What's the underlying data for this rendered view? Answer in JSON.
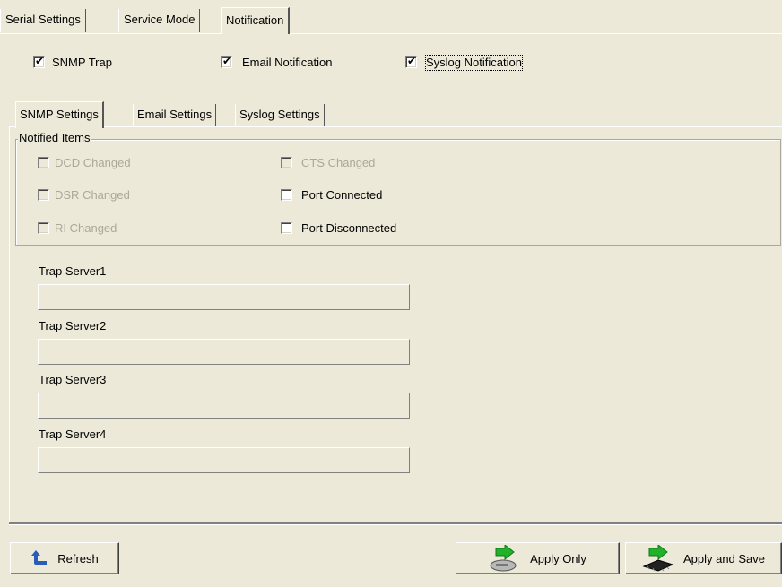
{
  "top_tabs": [
    {
      "label": "Serial Settings"
    },
    {
      "label": "Service Mode"
    },
    {
      "label": "Notification",
      "active": true
    }
  ],
  "notify_options": [
    {
      "label": "SNMP Trap",
      "checked": true
    },
    {
      "label": "Email Notification",
      "checked": true
    },
    {
      "label": "Syslog Notification",
      "checked": true,
      "focused": true
    }
  ],
  "inner_tabs": [
    {
      "label": "SNMP Settings",
      "active": true
    },
    {
      "label": "Email Settings"
    },
    {
      "label": "Syslog Settings"
    }
  ],
  "notified_items": {
    "title": "Notified Items",
    "items": [
      {
        "label": "DCD Changed",
        "checked": false,
        "enabled": false
      },
      {
        "label": "CTS Changed",
        "checked": false,
        "enabled": false
      },
      {
        "label": "DSR Changed",
        "checked": false,
        "enabled": false
      },
      {
        "label": "Port Connected",
        "checked": false,
        "enabled": true
      },
      {
        "label": "RI Changed",
        "checked": false,
        "enabled": false
      },
      {
        "label": "Port Disconnected",
        "checked": false,
        "enabled": true
      }
    ]
  },
  "trap_servers": [
    {
      "label": "Trap Server1",
      "value": ""
    },
    {
      "label": "Trap Server2",
      "value": ""
    },
    {
      "label": "Trap Server3",
      "value": ""
    },
    {
      "label": "Trap Server4",
      "value": ""
    }
  ],
  "buttons": {
    "refresh": "Refresh",
    "apply_only": "Apply Only",
    "apply_and_save": "Apply and Save"
  }
}
